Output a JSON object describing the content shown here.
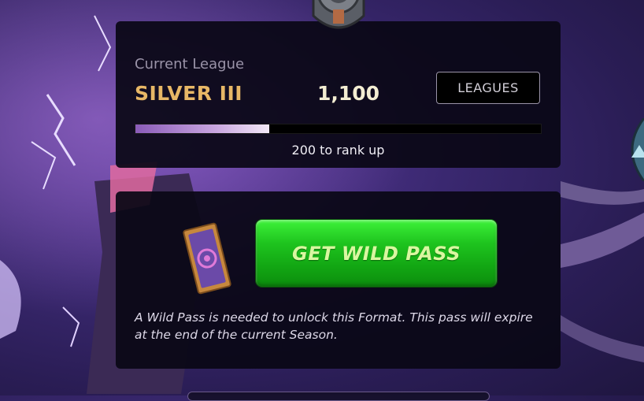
{
  "league": {
    "current_label": "Current League",
    "name": "SILVER III",
    "points": "1,100",
    "leagues_button": "LEAGUES",
    "progress_fraction": 0.33,
    "rank_up_text": "200 to rank up"
  },
  "wild_pass": {
    "button_label": "GET WILD PASS",
    "note": "A Wild Pass is needed to unlock this Format. This pass will expire at the end of the current Season."
  },
  "colors": {
    "league_name": "#e7b766",
    "button_green": "#1ec41e",
    "panel_bg": "#0a0816"
  },
  "icons": [
    "league-emblem-icon",
    "wild-pass-ticket-icon",
    "side-nav-icon"
  ]
}
